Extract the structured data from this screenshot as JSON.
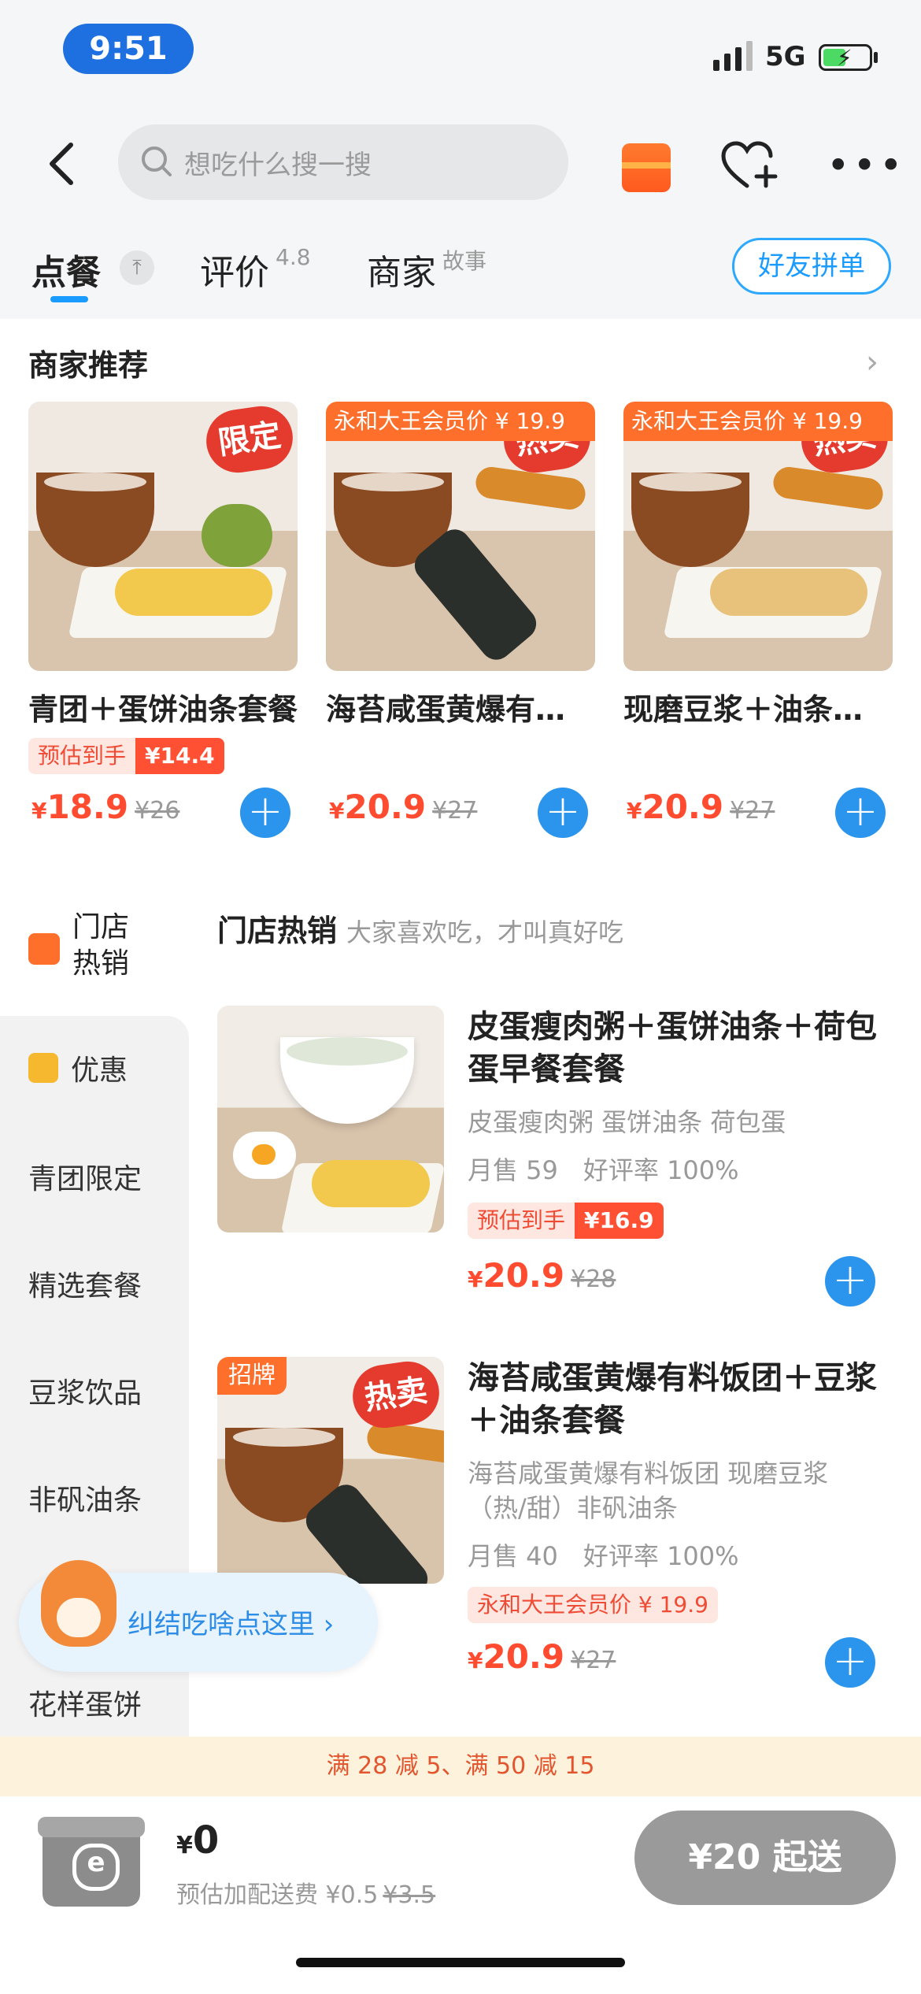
{
  "status_bar": {
    "time": "9:51",
    "network": "5G"
  },
  "nav": {
    "search_placeholder": "想吃什么搜一搜"
  },
  "tabs": {
    "order_label": "点餐",
    "review_label": "评价",
    "review_score": "4.8",
    "merchant_label": "商家",
    "merchant_sub": "故事",
    "friend_group_label": "好友拼单"
  },
  "recommend": {
    "title": "商家推荐",
    "items": [
      {
        "badge": "限定",
        "name": "青团＋蛋饼油条套餐",
        "est_label": "预估到手",
        "est_price": "¥14.4",
        "price": "18.9",
        "orig": "¥26"
      },
      {
        "badge": "热卖",
        "member": "永和大王会员价 ¥ 19.9",
        "name": "海苔咸蛋黄爆有料饭团套餐",
        "price": "20.9",
        "orig": "¥27"
      },
      {
        "badge": "热卖",
        "member": "永和大王会员价 ¥ 19.9",
        "name": "现磨豆浆＋油条蛋饼套餐",
        "price": "20.9",
        "orig": "¥27"
      }
    ]
  },
  "sidebar": {
    "hot_label": "门店热销",
    "items": [
      "优惠",
      "青团限定",
      "精选套餐",
      "豆浆饮品",
      "非矾油条",
      "花样蛋饼"
    ]
  },
  "section": {
    "title": "门店热销",
    "subtitle": "大家喜欢吃，才叫真好吃"
  },
  "menu_items": [
    {
      "title": "皮蛋瘦肉粥＋蛋饼油条＋荷包蛋早餐套餐",
      "desc": "皮蛋瘦肉粥 蛋饼油条 荷包蛋",
      "sales": "月售 59　好评率 100%",
      "est_label": "预估到手",
      "est_price": "¥16.9",
      "price": "20.9",
      "orig": "¥28"
    },
    {
      "tag": "招牌",
      "badge": "热卖",
      "title": "海苔咸蛋黄爆有料饭团＋豆浆＋油条套餐",
      "desc": "海苔咸蛋黄爆有料饭团 现磨豆浆（热/甜）非矾油条",
      "sales": "月售 40　好评率 100%",
      "member": "永和大王会员价 ¥ 19.9",
      "price": "20.9",
      "orig": "¥27"
    }
  ],
  "float_helper": {
    "label": "纠结吃啥点这里 ›"
  },
  "promo": {
    "text": "满 28 减 5、满 50 减 15"
  },
  "cart": {
    "currency": "¥",
    "total": "0",
    "fee_label": "预估加配送费 ¥0.5",
    "fee_orig": "¥3.5",
    "checkout_label": "¥20 起送"
  },
  "colors": {
    "accent_blue": "#2b95ee",
    "price_red": "#ff4b2f",
    "tag_orange": "#ff6f2c"
  }
}
